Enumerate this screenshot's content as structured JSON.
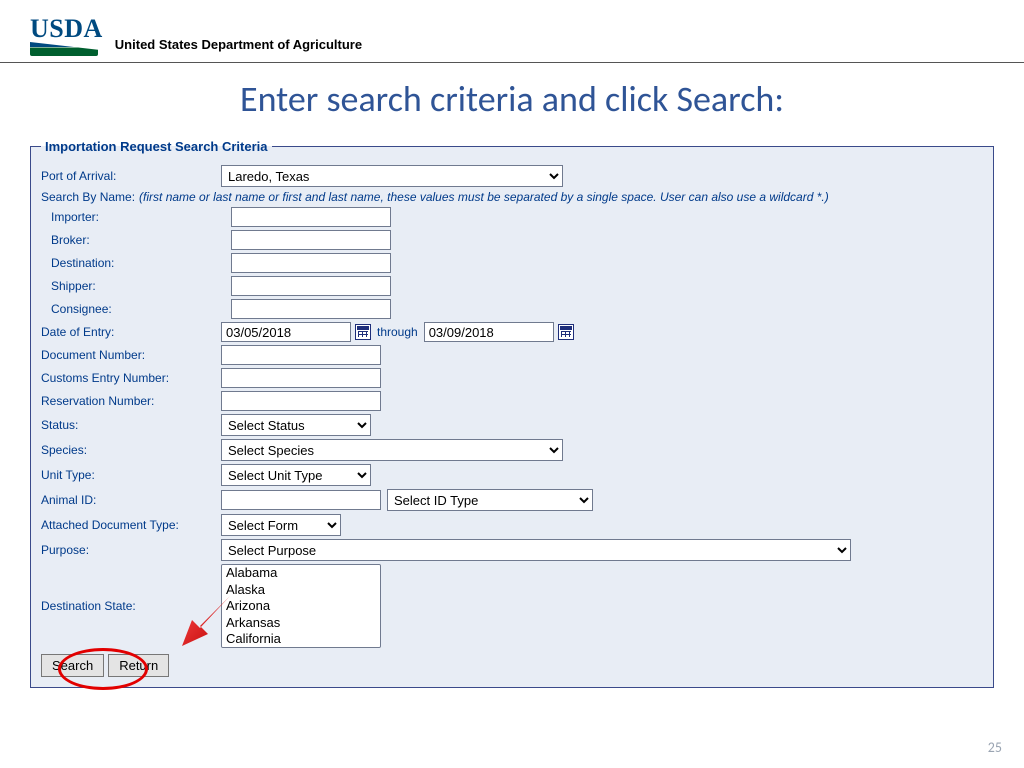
{
  "header": {
    "logo_text": "USDA",
    "department": "United States Department of Agriculture"
  },
  "slide_title": "Enter search criteria and click Search:",
  "legend": "Importation Request Search Criteria",
  "labels": {
    "port": "Port of Arrival:",
    "search_by_name": "Search By Name:",
    "search_hint": "(first name or last name or first and last name, these values must be separated by a single space. User can also use a wildcard *.)",
    "importer": "Importer:",
    "broker": "Broker:",
    "destination": "Destination:",
    "shipper": "Shipper:",
    "consignee": "Consignee:",
    "date_of_entry": "Date of Entry:",
    "through": "through",
    "doc_number": "Document Number:",
    "customs": "Customs Entry Number:",
    "reservation": "Reservation Number:",
    "status": "Status:",
    "species": "Species:",
    "unit_type": "Unit Type:",
    "animal_id": "Animal ID:",
    "attached_doc": "Attached Document Type:",
    "purpose": "Purpose:",
    "dest_state": "Destination State:"
  },
  "values": {
    "port": "Laredo, Texas",
    "date_from": "03/05/2018",
    "date_to": "03/09/2018",
    "status": "Select Status",
    "species": "Select Species",
    "unit_type": "Select Unit Type",
    "id_type": "Select ID Type",
    "form": "Select Form",
    "purpose": "Select Purpose"
  },
  "states": [
    "Alabama",
    "Alaska",
    "Arizona",
    "Arkansas",
    "California"
  ],
  "buttons": {
    "search": "Search",
    "return": "Return"
  },
  "colors": {
    "form_bg": "#e8edf5",
    "label_blue": "#003a8a",
    "title_blue": "#2f5496",
    "annotation_red": "#e20000"
  },
  "page_number": "25"
}
